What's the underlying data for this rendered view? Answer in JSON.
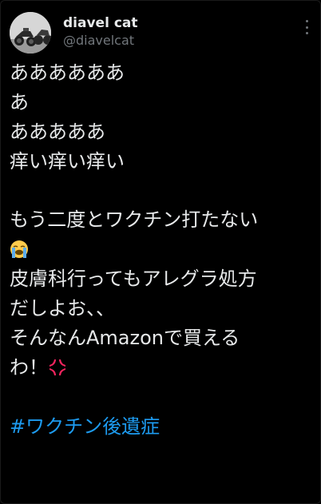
{
  "post": {
    "author": {
      "display_name": "diavel cat",
      "handle": "@diavelcat",
      "avatar": "motorcycle-photo"
    },
    "more_icon": "more-vertical-icon",
    "lines": [
      "ああああああ",
      "あ",
      "あああああ",
      "痒い痒い痒い",
      "",
      "もう二度とワクチン打たない",
      "",
      "皮膚科行ってもアレグラ処方",
      "だしよお、、",
      "そんなんAmazonで買える",
      "わ！",
      "",
      "#ワクチン後遺症"
    ],
    "emojis": {
      "crying": "loudly-crying-face-emoji",
      "anger": "anger-symbol-emoji"
    },
    "hashtag": "#ワクチン後遺症"
  },
  "colors": {
    "background": "#000000",
    "text": "#e7e9ea",
    "secondary": "#71767b",
    "link": "#1d9bf0",
    "anger": "#f4245e"
  }
}
